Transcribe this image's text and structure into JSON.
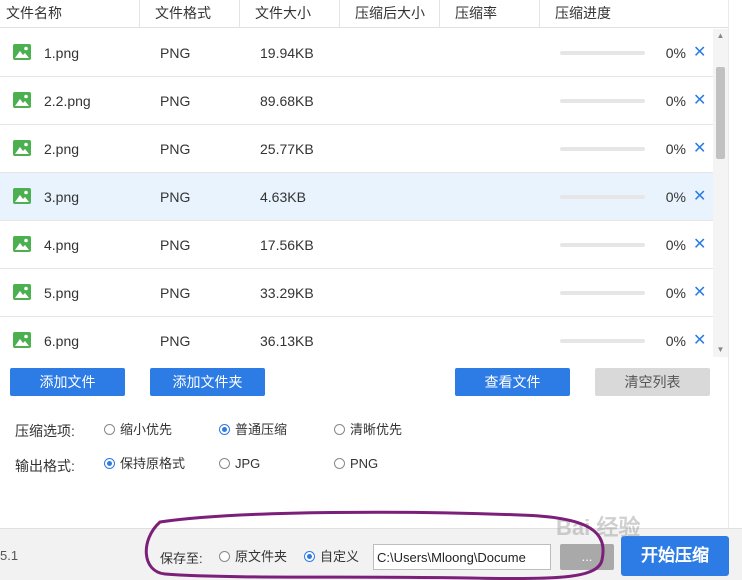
{
  "table": {
    "headers": [
      "文件名称",
      "文件格式",
      "文件大小",
      "压缩后大小",
      "压缩率",
      "压缩进度"
    ],
    "rows": [
      {
        "name": "1.png",
        "format": "PNG",
        "size": "19.94KB",
        "after": "",
        "ratio": "",
        "progress": 0,
        "progress_text": "0%"
      },
      {
        "name": "2.2.png",
        "format": "PNG",
        "size": "89.68KB",
        "after": "",
        "ratio": "",
        "progress": 0,
        "progress_text": "0%"
      },
      {
        "name": "2.png",
        "format": "PNG",
        "size": "25.77KB",
        "after": "",
        "ratio": "",
        "progress": 0,
        "progress_text": "0%"
      },
      {
        "name": "3.png",
        "format": "PNG",
        "size": "4.63KB",
        "after": "",
        "ratio": "",
        "progress": 0,
        "progress_text": "0%",
        "selected": true
      },
      {
        "name": "4.png",
        "format": "PNG",
        "size": "17.56KB",
        "after": "",
        "ratio": "",
        "progress": 0,
        "progress_text": "0%"
      },
      {
        "name": "5.png",
        "format": "PNG",
        "size": "33.29KB",
        "after": "",
        "ratio": "",
        "progress": 0,
        "progress_text": "0%"
      },
      {
        "name": "6.png",
        "format": "PNG",
        "size": "36.13KB",
        "after": "",
        "ratio": "",
        "progress": 0,
        "progress_text": "0%"
      }
    ],
    "delete_glyph": "✕"
  },
  "buttons": {
    "add_file": "添加文件",
    "add_folder": "添加文件夹",
    "view_files": "查看文件",
    "clear_list": "清空列表"
  },
  "compress_options": {
    "label": "压缩选项:",
    "options": [
      "缩小优先",
      "普通压缩",
      "清晰优先"
    ],
    "selected": "普通压缩"
  },
  "output_format": {
    "label": "输出格式:",
    "options": [
      "保持原格式",
      "JPG",
      "PNG"
    ],
    "selected": "保持原格式"
  },
  "footer": {
    "version": "5.1",
    "save_label": "保存至:",
    "save_options": [
      "原文件夹",
      "自定义"
    ],
    "save_selected": "自定义",
    "path_value": "C:\\Users\\Mloong\\Docume",
    "browse_label": "...",
    "start_label": "开始压缩"
  },
  "watermark": "Bai 经验",
  "colors": {
    "accent": "#2d7be5",
    "selected_row": "#e8f3fd",
    "annotation": "#7b1f7a",
    "icon_green": "#4caf50"
  }
}
